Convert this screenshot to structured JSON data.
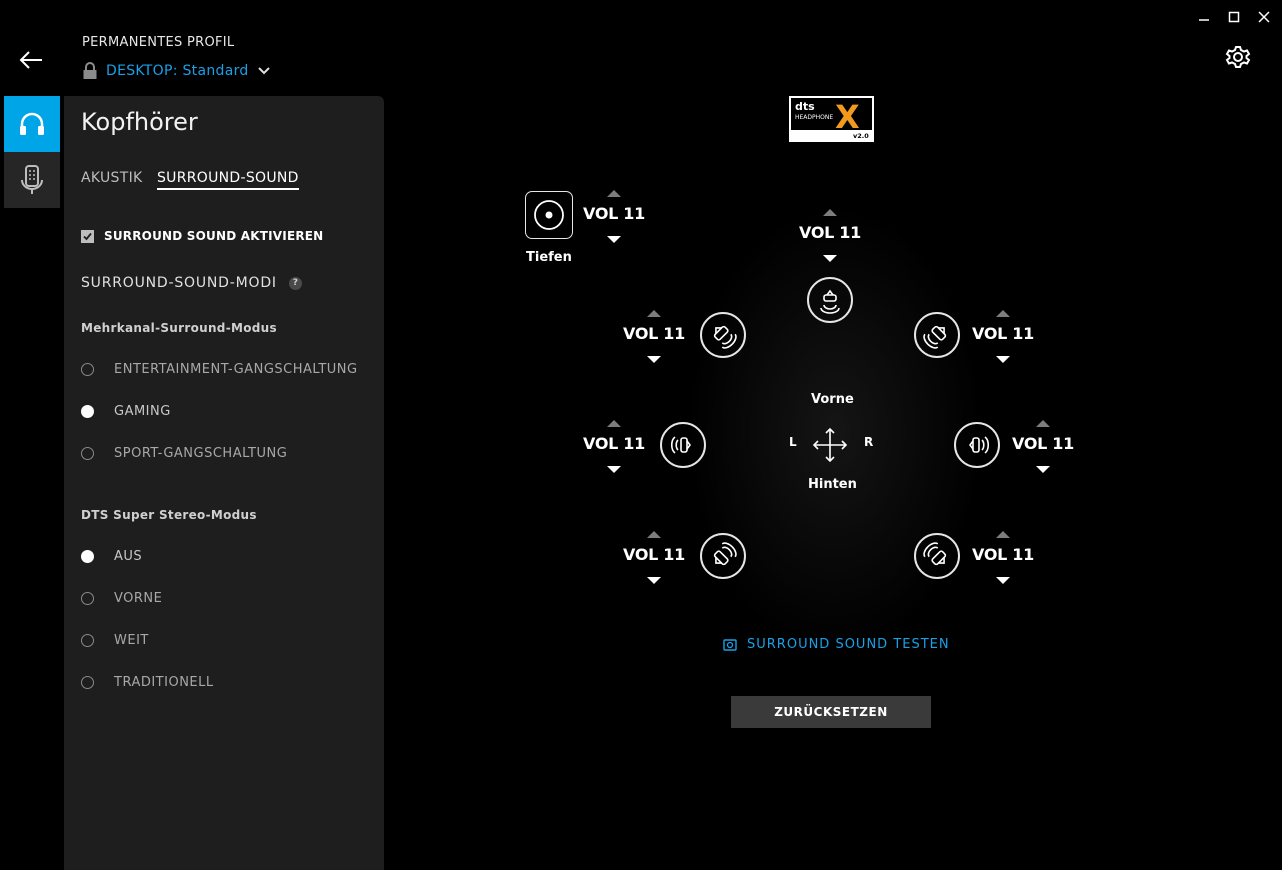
{
  "window": {
    "minimize_icon": "minimize-icon",
    "maximize_icon": "maximize-icon",
    "close_icon": "close-icon"
  },
  "header": {
    "profile_label": "PERMANENTES PROFIL",
    "profile_value": "DESKTOP: Standard",
    "back_icon": "arrow-left-icon",
    "settings_icon": "gear-icon"
  },
  "device_tabs": [
    {
      "name": "headphones",
      "icon": "headphones-icon",
      "active": true
    },
    {
      "name": "microphone",
      "icon": "microphone-icon",
      "active": false
    }
  ],
  "panel": {
    "title": "Kopfhörer",
    "tabs": [
      {
        "label": "AKUSTIK",
        "active": false
      },
      {
        "label": "SURROUND-SOUND",
        "active": true
      }
    ],
    "enable_label": "SURROUND SOUND AKTIVIEREN",
    "enable_checked": true,
    "modes_label": "SURROUND-SOUND-MODI",
    "help_label": "?",
    "multichannel": {
      "label": "Mehrkanal-Surround-Modus",
      "options": [
        {
          "label": "ENTERTAINMENT-GANGSCHALTUNG",
          "selected": false
        },
        {
          "label": "GAMING",
          "selected": true
        },
        {
          "label": "SPORT-GANGSCHALTUNG",
          "selected": false
        }
      ]
    },
    "stereo": {
      "label": "DTS Super Stereo-Modus",
      "options": [
        {
          "label": "AUS",
          "selected": true
        },
        {
          "label": "VORNE",
          "selected": false
        },
        {
          "label": "WEIT",
          "selected": false
        },
        {
          "label": "TRADITIONELL",
          "selected": false
        }
      ]
    }
  },
  "mixer": {
    "dts_logo": {
      "brand": "dts",
      "line": "HEADPHONE",
      "mark": "X",
      "version": "v2.0"
    },
    "subwoofer_label": "Tiefen",
    "volumes": {
      "subwoofer": "VOL 11",
      "center": "VOL 11",
      "front_left": "VOL 11",
      "front_right": "VOL 11",
      "side_left": "VOL 11",
      "side_right": "VOL 11",
      "rear_left": "VOL 11",
      "rear_right": "VOL 11"
    },
    "direction": {
      "front": "Vorne",
      "back": "Hinten",
      "left": "L",
      "right": "R"
    },
    "test_label": "SURROUND SOUND TESTEN",
    "reset_label": "ZURÜCKSETZEN"
  },
  "colors": {
    "accent": "#00a5e8",
    "link": "#1aa0e6",
    "panel": "#1e1e1e",
    "background": "#000000"
  }
}
